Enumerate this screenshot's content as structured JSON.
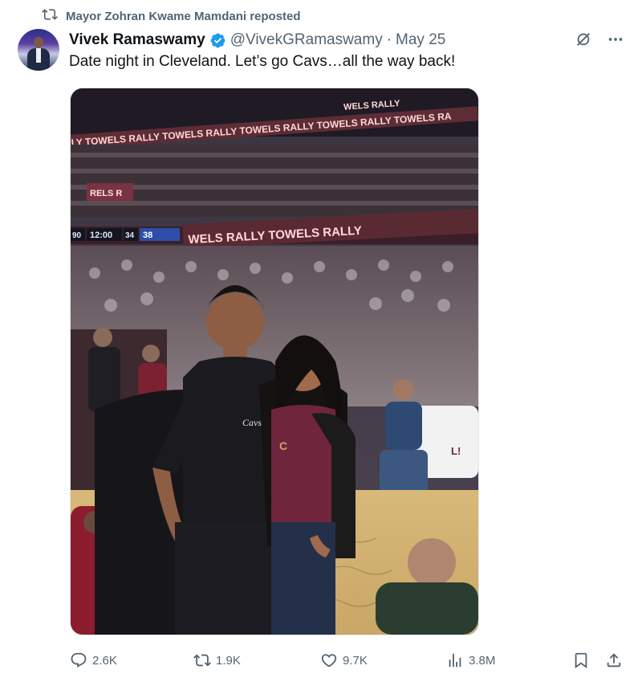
{
  "repost": {
    "text": "Mayor Zohran Kwame Mamdani reposted"
  },
  "tweet": {
    "author_name": "Vivek Ramaswamy",
    "handle": "@VivekGRamaswamy",
    "separator": "·",
    "date": "May 25",
    "text": "Date night in Cleveland. Let’s go Cavs…all the way back!"
  },
  "photo": {
    "ribbon_upper": "LY TOWELS RALLY TOWELS RALLY TOWELS RALLY TOWELS RALLY TOWELS RA",
    "ribbon_top": "WELS RALLY",
    "ribbon_lower": "WELS RALLY TOWELS RALLY",
    "ribbon_side": "RELS R",
    "clock": "12:00",
    "score_left": "90",
    "score_mid": "34",
    "score_right": "38",
    "shirt_logo": "Cavs",
    "fan_shirt_text": "L!"
  },
  "actions": {
    "replies": "2.6K",
    "reposts": "1.9K",
    "likes": "9.7K",
    "views": "3.8M"
  },
  "colors": {
    "text_primary": "#0f1419",
    "text_secondary": "#536471",
    "verified_blue": "#1d9bf0",
    "cavs_wine": "#6f263d"
  },
  "icons": [
    "repost-icon",
    "verified-icon",
    "grok-icon",
    "more-icon",
    "reply-icon",
    "retweet-icon",
    "like-icon",
    "views-icon",
    "bookmark-icon",
    "share-icon"
  ]
}
